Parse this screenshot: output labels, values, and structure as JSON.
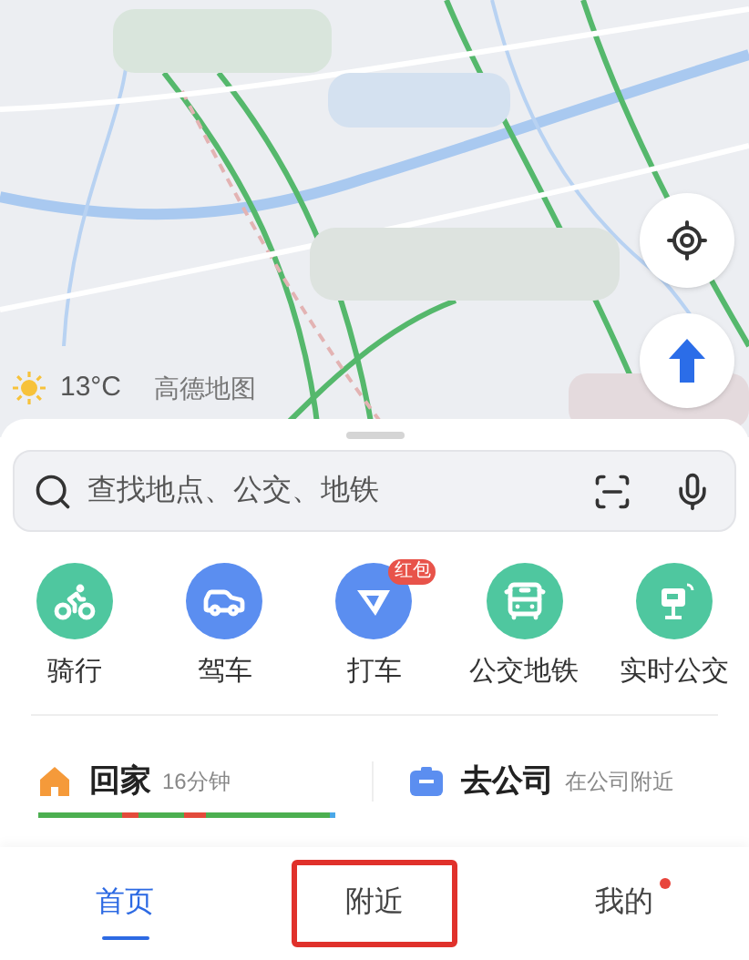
{
  "map": {
    "weather": {
      "temperature": "13°C"
    },
    "logo": "高德地图"
  },
  "search": {
    "placeholder": "查找地点、公交、地铁"
  },
  "shortcuts": [
    {
      "label": "骑行",
      "kind": "bike",
      "color": "#4fc79f"
    },
    {
      "label": "驾车",
      "kind": "car",
      "color": "#5b8ef0"
    },
    {
      "label": "打车",
      "kind": "taxi",
      "color": "#5b8ef0",
      "badge": "红包"
    },
    {
      "label": "公交地铁",
      "kind": "bus",
      "color": "#4fc79f"
    },
    {
      "label": "实时公交",
      "kind": "realtime",
      "color": "#4fc79f"
    }
  ],
  "commute": [
    {
      "kind": "home",
      "title": "回家",
      "detail": "16分钟"
    },
    {
      "kind": "work",
      "title": "去公司",
      "detail": "在公司附近"
    }
  ],
  "tabs": [
    {
      "label": "首页",
      "selected": true,
      "highlighted": false,
      "dot": false
    },
    {
      "label": "附近",
      "selected": false,
      "highlighted": true,
      "dot": false
    },
    {
      "label": "我的",
      "selected": false,
      "highlighted": false,
      "dot": true
    }
  ]
}
